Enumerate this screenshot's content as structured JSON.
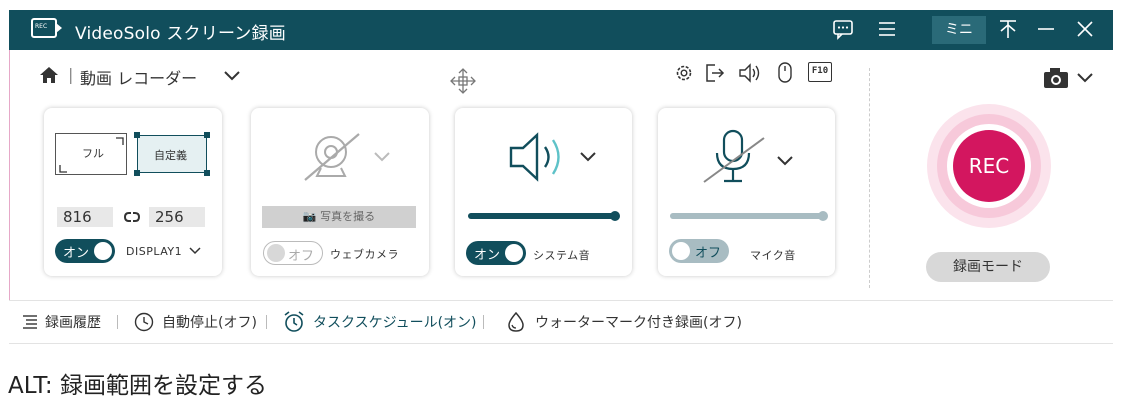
{
  "app": {
    "title": "VideoSolo スクリーン録画",
    "logo_text": "REC",
    "window_buttons": {
      "chat_icon": "chat-icon",
      "menu_icon": "menu-icon",
      "mini_label": "ミニ",
      "pin_icon": "pin-icon",
      "minimize_icon": "minimize-icon",
      "close_icon": "close-icon"
    }
  },
  "nav": {
    "home_icon": "home-icon",
    "separator": "|",
    "mode_label": "動画 レコーダー",
    "move_icon": "move-icon"
  },
  "toolbar": [
    "gear-icon",
    "export-icon",
    "speaker-icon",
    "mouse-icon",
    "hotkey-icon"
  ],
  "toolbar_hotkey_text": "F10",
  "screen_card": {
    "full_label": "フル",
    "custom_label": "自定義",
    "width": "816",
    "height": "256",
    "link_icon": "link-icon",
    "toggle_label": "オン",
    "toggle_state": "on",
    "display_label": "DISPLAY1",
    "display_arrow": "⌄"
  },
  "webcam_card": {
    "photo_button": "写真を撮る",
    "toggle_label": "オフ",
    "toggle_state": "off",
    "label": "ウェブカメラ"
  },
  "system_audio_card": {
    "toggle_label": "オン",
    "toggle_state": "on",
    "label": "システム音",
    "volume": 1.0
  },
  "mic_card": {
    "toggle_label": "オフ",
    "toggle_state": "off",
    "label": "マイク音",
    "volume": 1.0
  },
  "record": {
    "rec_label": "REC",
    "mode_button": "録画モード",
    "camera_icon": "camera-icon"
  },
  "bottom_bar": {
    "history": "録画履歴",
    "auto_stop": "自動停止(オフ)",
    "schedule": "タスクスケジュール(オン)",
    "watermark": "ウォーターマーク付き録画(オフ)"
  },
  "alt_text": "ALT:  録画範囲を設定する",
  "colors": {
    "titlebar": "#114e5c",
    "accent": "#114e5c",
    "rec": "#d3165f",
    "rec_ring": "#f2b9cf"
  }
}
